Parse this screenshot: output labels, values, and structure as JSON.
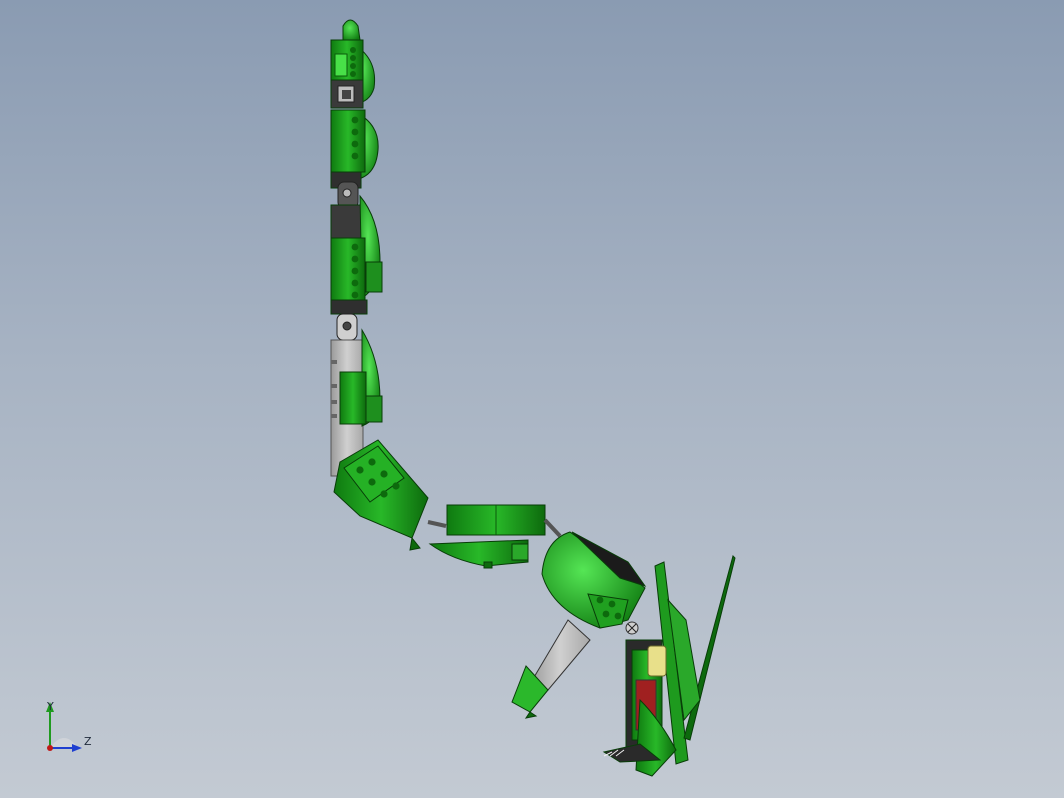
{
  "viewport": {
    "background_top": "#8a9bb2",
    "background_bottom": "#c3cad3"
  },
  "model": {
    "part_colors": {
      "green": "#1fa21f",
      "green_light": "#3ed63e",
      "green_dark": "#0d6a0d",
      "dark_gray": "#3b3b3b",
      "light_gray": "#bdbdbd",
      "yellow": "#e8e08a"
    }
  },
  "triad": {
    "y_label": "Y",
    "z_label": "Z",
    "y_color": "#1f9a1f",
    "z_color": "#1f3fd0",
    "origin_color": "#c01818"
  }
}
